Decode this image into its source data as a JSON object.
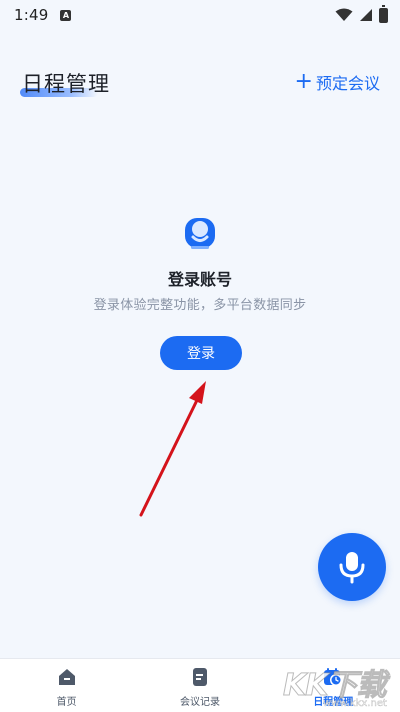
{
  "status_bar": {
    "time": "1:49",
    "app_indicator": "A",
    "icons": [
      "wifi-icon",
      "signal-icon",
      "battery-icon"
    ]
  },
  "header": {
    "title": "日程管理",
    "book_meeting_icon": "plus-icon",
    "book_meeting_label": "预定会议"
  },
  "empty_state": {
    "icon": "user-avatar-icon",
    "heading": "登录账号",
    "subtitle": "登录体验完整功能，多平台数据同步",
    "login_button": "登录"
  },
  "voice_button": {
    "icon": "microphone-icon"
  },
  "bottom_nav": {
    "items": [
      {
        "label": "首页",
        "icon": "home-icon",
        "active": false
      },
      {
        "label": "会议记录",
        "icon": "document-icon",
        "active": false
      },
      {
        "label": "日程管理",
        "icon": "calendar-clock-icon",
        "active": true
      }
    ]
  },
  "annotation": {
    "type": "red-arrow",
    "points_to": "login-button"
  },
  "watermark": {
    "text": "KK下载",
    "url": "www.kkx.net"
  },
  "colors": {
    "accent": "#1c6bf2",
    "background": "#f3f7fd",
    "text_primary": "#1d2129",
    "text_secondary": "#8a94a6",
    "annotation": "#d4131b"
  }
}
